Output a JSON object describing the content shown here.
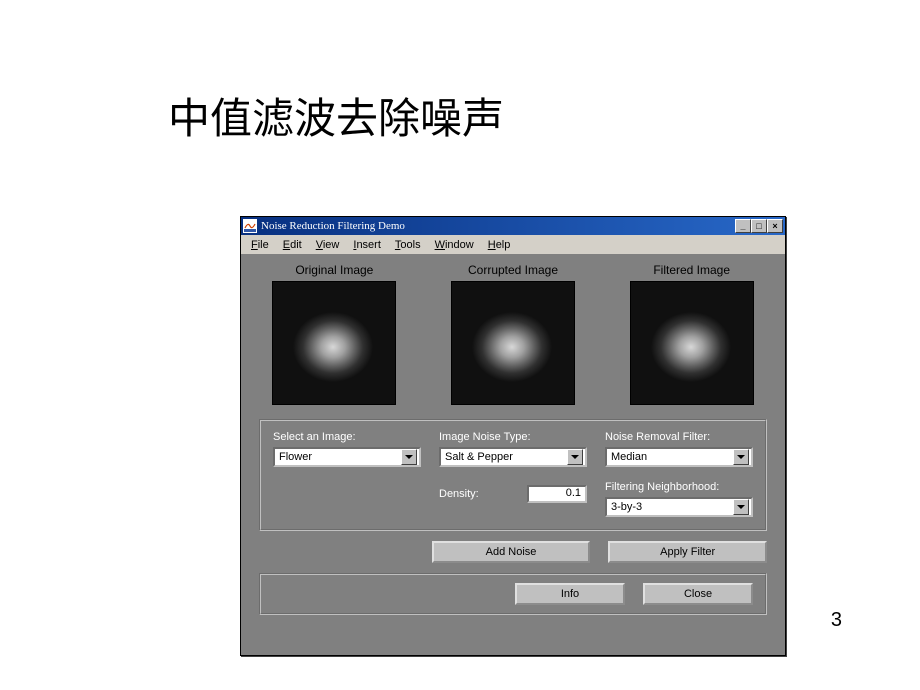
{
  "slide": {
    "title": "中值滤波去除噪声",
    "page_number": "3"
  },
  "window": {
    "title": "Noise Reduction Filtering Demo",
    "controls": {
      "minimize": "_",
      "maximize": "□",
      "close": "×"
    }
  },
  "menu": {
    "file": "File",
    "edit": "Edit",
    "view": "View",
    "insert": "Insert",
    "tools": "Tools",
    "window": "Window",
    "help": "Help"
  },
  "images": {
    "original": "Original Image",
    "corrupted": "Corrupted Image",
    "filtered": "Filtered Image"
  },
  "controls": {
    "select_image_label": "Select an Image:",
    "select_image_value": "Flower",
    "noise_type_label": "Image Noise Type:",
    "noise_type_value": "Salt & Pepper",
    "density_label": "Density:",
    "density_value": "0.1",
    "filter_label": "Noise Removal Filter:",
    "filter_value": "Median",
    "neighborhood_label": "Filtering Neighborhood:",
    "neighborhood_value": "3-by-3",
    "add_noise_btn": "Add Noise",
    "apply_filter_btn": "Apply Filter"
  },
  "bottom": {
    "info_btn": "Info",
    "close_btn": "Close"
  }
}
